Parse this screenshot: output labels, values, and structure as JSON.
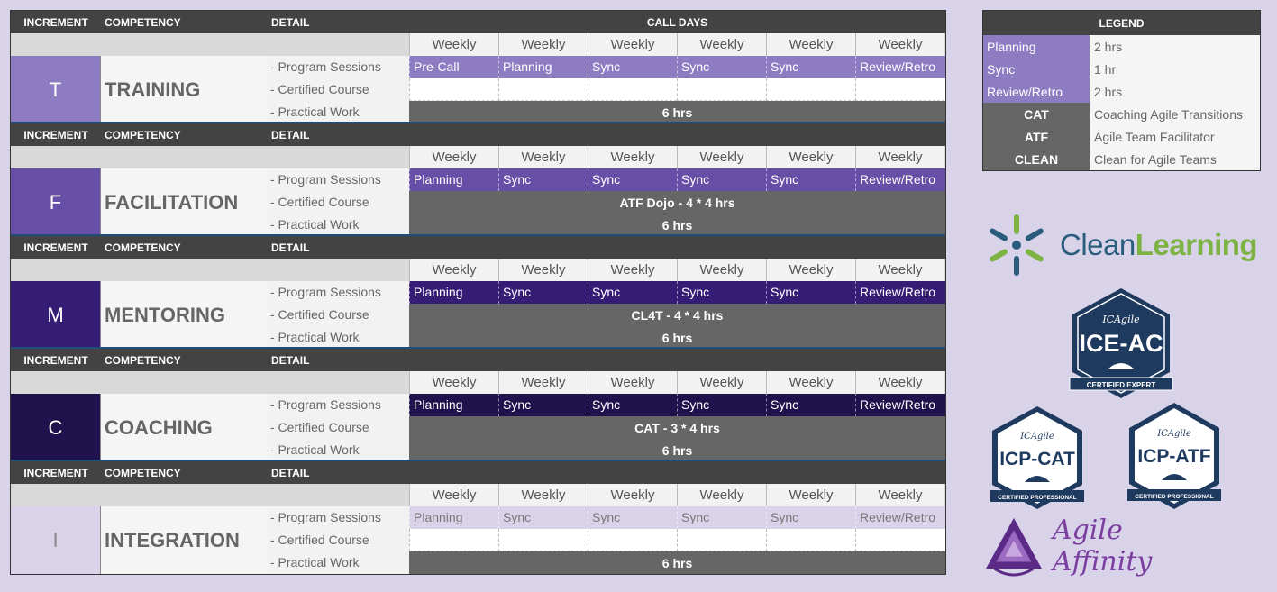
{
  "header": {
    "increment": "INCREMENT",
    "competency": "COMPETENCY",
    "detail": "DETAIL",
    "call_days": "CALL DAYS"
  },
  "weekly": [
    "Weekly",
    "Weekly",
    "Weekly",
    "Weekly",
    "Weekly",
    "Weekly"
  ],
  "details": [
    "- Program Sessions",
    "- Certified Course",
    "- Practical Work"
  ],
  "sections": [
    {
      "letter": "T",
      "name": "TRAINING",
      "color": "#8e7cc3",
      "sess_color": "#8e7cc3",
      "sess_text": "#ffffff",
      "sessions": [
        "Pre-Call",
        "Planning",
        "Sync",
        "Sync",
        "Sync",
        "Review/Retro"
      ],
      "course": "",
      "practical": "6 hrs"
    },
    {
      "letter": "F",
      "name": "FACILITATION",
      "color": "#674ea7",
      "sess_color": "#674ea7",
      "sess_text": "#ffffff",
      "sessions": [
        "Planning",
        "Sync",
        "Sync",
        "Sync",
        "Sync",
        "Review/Retro"
      ],
      "course": "ATF Dojo - 4 * 4 hrs",
      "practical": "6 hrs"
    },
    {
      "letter": "M",
      "name": "MENTORING",
      "color": "#351c75",
      "sess_color": "#351c75",
      "sess_text": "#ffffff",
      "sessions": [
        "Planning",
        "Sync",
        "Sync",
        "Sync",
        "Sync",
        "Review/Retro"
      ],
      "course": "CL4T - 4 * 4 hrs",
      "practical": "6 hrs"
    },
    {
      "letter": "C",
      "name": "COACHING",
      "color": "#20124d",
      "sess_color": "#20124d",
      "sess_text": "#ffffff",
      "sessions": [
        "Planning",
        "Sync",
        "Sync",
        "Sync",
        "Sync",
        "Review/Retro"
      ],
      "course": "CAT - 3 * 4 hrs",
      "practical": "6 hrs"
    },
    {
      "letter": "I",
      "name": "INTEGRATION",
      "color": "#d9d2e9",
      "sess_color": "#d9d2e9",
      "sess_text": "#777777",
      "sessions": [
        "Planning",
        "Sync",
        "Sync",
        "Sync",
        "Sync",
        "Review/Retro"
      ],
      "course": "",
      "practical": "6 hrs"
    }
  ],
  "legend": {
    "title": "LEGEND",
    "rows": [
      {
        "key": "Planning",
        "value": "2 hrs",
        "style": "purple"
      },
      {
        "key": "Sync",
        "value": "1 hr",
        "style": "purple"
      },
      {
        "key": "Review/Retro",
        "value": "2 hrs",
        "style": "purple"
      },
      {
        "key": "CAT",
        "value": "Coaching Agile Transitions",
        "style": "dark"
      },
      {
        "key": "ATF",
        "value": "Agile Team Facilitator",
        "style": "dark"
      },
      {
        "key": "CLEAN",
        "value": "Clean for Agile Teams",
        "style": "dark"
      }
    ]
  },
  "logos": {
    "clean_a": "Clean",
    "clean_b": "Learning",
    "ice_ac": "ICE-AC",
    "ice_ac_sub": "CERTIFIED EXPERT",
    "icp_cat": "ICP-CAT",
    "icp_atf": "ICP-ATF",
    "icp_sub": "CERTIFIED PROFESSIONAL",
    "ic_mark": "ICAgile",
    "agile_affinity": "Agile Affinity"
  },
  "colors": {
    "clean_blue": "#2a5d7c",
    "clean_green": "#7cb342",
    "badge_navy": "#1f3a5f",
    "affinity_purple": "#7b3fa0"
  }
}
